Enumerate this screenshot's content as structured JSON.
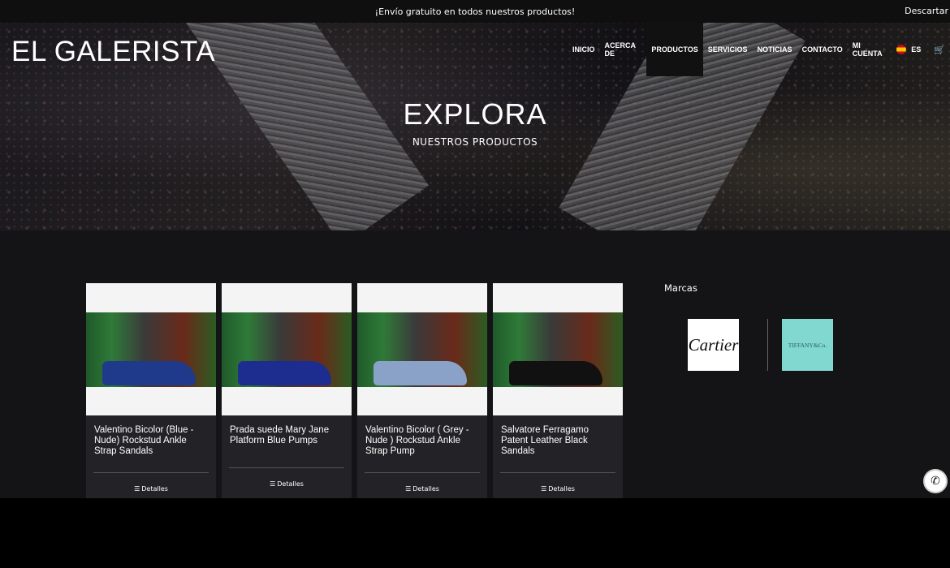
{
  "topbar": {
    "message": "¡Envío gratuito en todos nuestros productos!",
    "dismiss": "Descartar"
  },
  "header": {
    "logo": "EL GALERISTA",
    "nav": [
      {
        "label": "INICIO",
        "active": false
      },
      {
        "label": "ACERCA DE",
        "active": false
      },
      {
        "label": "PRODUCTOS",
        "active": true
      },
      {
        "label": "SERVICIOS",
        "active": false
      },
      {
        "label": "NOTICIAS",
        "active": false
      },
      {
        "label": "CONTACTO",
        "active": false
      },
      {
        "label": "MI CUENTA",
        "active": false
      }
    ],
    "language": "ES",
    "cart_icon": "cart-icon"
  },
  "hero": {
    "title": "EXPLORA",
    "subtitle": "NUESTROS PRODUCTOS"
  },
  "products": [
    {
      "title": "Valentino Bicolor (Blue - Nude) Rockstud Ankle Strap Sandals",
      "button": "Detalles",
      "shoe_color": "#1f3a8a"
    },
    {
      "title": "Prada suede Mary Jane Platform Blue Pumps",
      "button": "Detalles",
      "shoe_color": "#1c2d8f"
    },
    {
      "title": "Valentino Bicolor ( Grey - Nude ) Rockstud Ankle Strap Pump",
      "button": "Detalles",
      "shoe_color": "#8aa2c8"
    },
    {
      "title": "Salvatore Ferragamo Patent Leather Black Sandals",
      "button": "Detalles",
      "shoe_color": "#111111"
    }
  ],
  "brands": {
    "title": "Marcas",
    "items": [
      "Cartier",
      "TIFFANY&Co."
    ]
  },
  "whatsapp_icon": "whatsapp-icon"
}
